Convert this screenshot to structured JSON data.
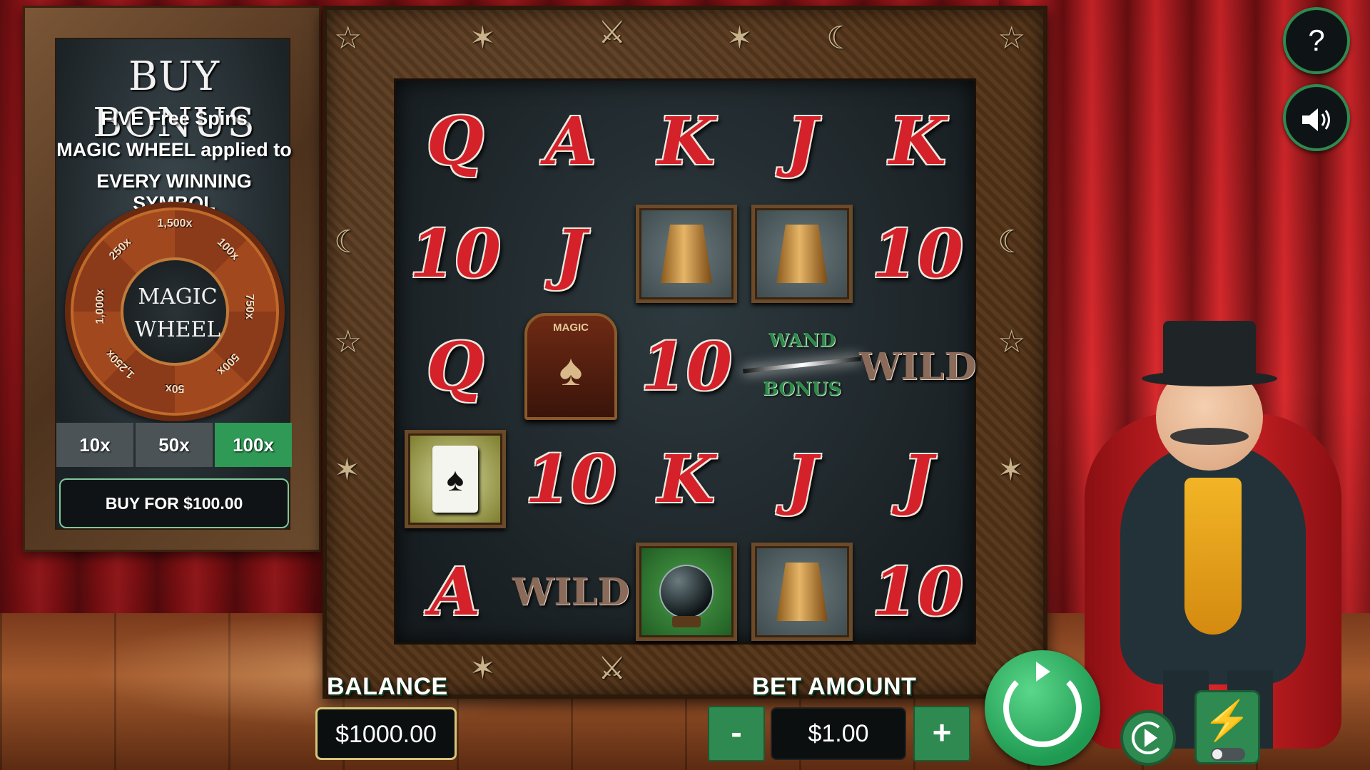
{
  "buy_bonus": {
    "title": "BUY BONUS",
    "line1": "FIVE Free Spins",
    "line2": "MAGIC WHEEL applied to",
    "line3": "EVERY WINNING SYMBOL",
    "wheel": {
      "center_line1": "MAGIC",
      "center_line2": "WHEEL",
      "segments": [
        "1,500x",
        "100x",
        "750x",
        "500x",
        "50x",
        "1,250x",
        "1,000x",
        "250x"
      ]
    },
    "multipliers": [
      "10x",
      "50x",
      "100x"
    ],
    "selected_multiplier": "100x",
    "buy_button": "BUY FOR $100.00"
  },
  "reels": {
    "rows": [
      [
        "Q",
        "A",
        "K",
        "J",
        "K"
      ],
      [
        "10",
        "J",
        "cup",
        "cup",
        "10"
      ],
      [
        "Q",
        "magic-door",
        "10",
        "wand-bonus",
        "WILD"
      ],
      [
        "ace-card",
        "10",
        "K",
        "J",
        "J"
      ],
      [
        "A",
        "WILD",
        "crystal-ball",
        "cup",
        "10"
      ]
    ],
    "magic_door_label": "MAGIC",
    "wand_bonus_top": "WAND",
    "wand_bonus_bottom": "BONUS",
    "wild_label": "WILD"
  },
  "controls": {
    "balance_label": "BALANCE",
    "balance_value": "$1000.00",
    "bet_label": "BET AMOUNT",
    "bet_value": "$1.00",
    "minus": "-",
    "plus": "+",
    "help": "?",
    "sound_icon": "speaker-icon"
  }
}
